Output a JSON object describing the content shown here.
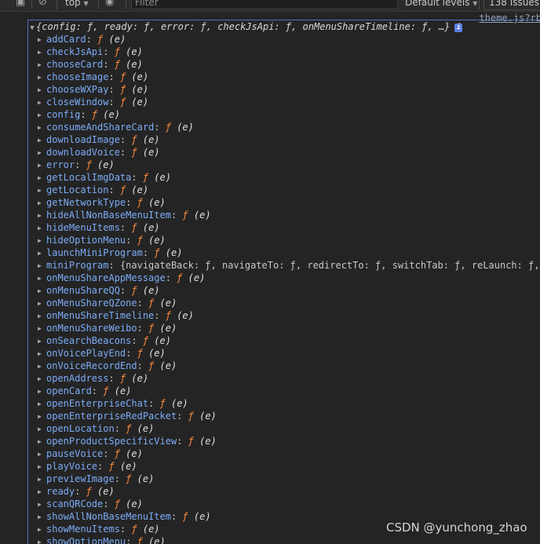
{
  "toolbar": {
    "context": "top",
    "filter_placeholder": "Filter",
    "levels": "Default levels",
    "issues": "138 Issues:"
  },
  "source_link": "theme.js?rb",
  "summary": "{config: ƒ, ready: ƒ, error: ƒ, checkJsApi: ƒ, onMenuShareTimeline: ƒ, …}",
  "f_symbol": "ƒ",
  "f_sig": "(e)",
  "properties": [
    {
      "key": "addCard"
    },
    {
      "key": "checkJsApi"
    },
    {
      "key": "chooseCard"
    },
    {
      "key": "chooseImage"
    },
    {
      "key": "chooseWXPay"
    },
    {
      "key": "closeWindow"
    },
    {
      "key": "config"
    },
    {
      "key": "consumeAndShareCard"
    },
    {
      "key": "downloadImage"
    },
    {
      "key": "downloadVoice"
    },
    {
      "key": "error"
    },
    {
      "key": "getLocalImgData"
    },
    {
      "key": "getLocation"
    },
    {
      "key": "getNetworkType"
    },
    {
      "key": "hideAllNonBaseMenuItem"
    },
    {
      "key": "hideMenuItems"
    },
    {
      "key": "hideOptionMenu"
    },
    {
      "key": "launchMiniProgram"
    },
    {
      "key": "miniProgram",
      "preview": "{navigateBack: ƒ, navigateTo: ƒ, redirectTo: ƒ, switchTab: ƒ, reLaunch: ƒ, …}"
    },
    {
      "key": "onMenuShareAppMessage"
    },
    {
      "key": "onMenuShareQQ"
    },
    {
      "key": "onMenuShareQZone"
    },
    {
      "key": "onMenuShareTimeline"
    },
    {
      "key": "onMenuShareWeibo"
    },
    {
      "key": "onSearchBeacons"
    },
    {
      "key": "onVoicePlayEnd"
    },
    {
      "key": "onVoiceRecordEnd"
    },
    {
      "key": "openAddress"
    },
    {
      "key": "openCard"
    },
    {
      "key": "openEnterpriseChat"
    },
    {
      "key": "openEnterpriseRedPacket"
    },
    {
      "key": "openLocation"
    },
    {
      "key": "openProductSpecificView"
    },
    {
      "key": "pauseVoice"
    },
    {
      "key": "playVoice"
    },
    {
      "key": "previewImage"
    },
    {
      "key": "ready"
    },
    {
      "key": "scanQRCode"
    },
    {
      "key": "showAllNonBaseMenuItem"
    },
    {
      "key": "showMenuItems"
    },
    {
      "key": "showOptionMenu"
    }
  ],
  "watermark": "CSDN @yunchong_zhao"
}
